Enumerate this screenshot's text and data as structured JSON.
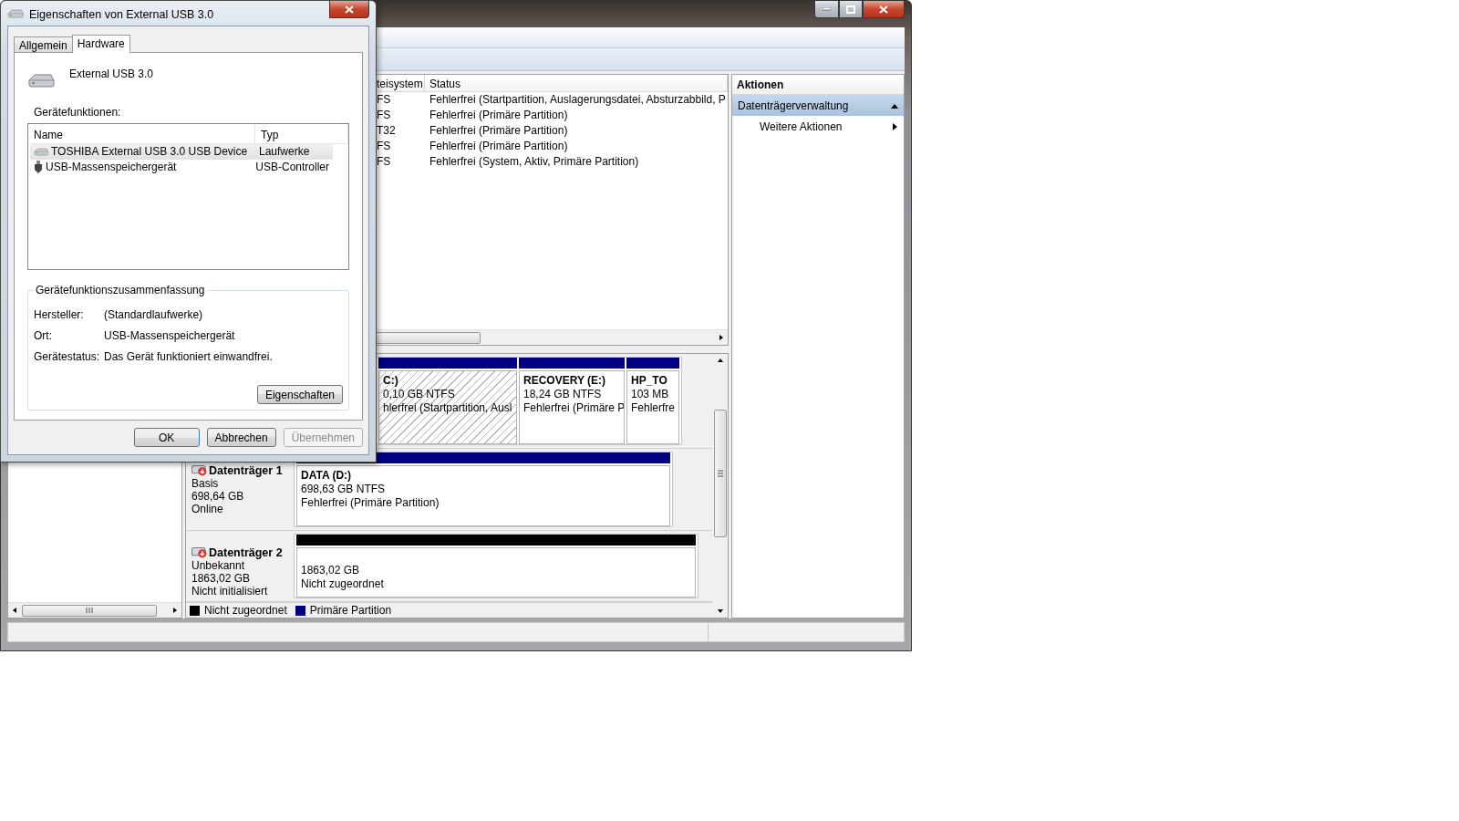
{
  "volume_list": {
    "columns": [
      "teisystem",
      "Status"
    ],
    "rows": [
      [
        "FS",
        "Fehlerfrei (Startpartition, Auslagerungsdatei, Absturzabbild, P"
      ],
      [
        "FS",
        "Fehlerfrei (Primäre Partition)"
      ],
      [
        "T32",
        "Fehlerfrei (Primäre Partition)"
      ],
      [
        "FS",
        "Fehlerfrei (Primäre Partition)"
      ],
      [
        "FS",
        "Fehlerfrei (System, Aktiv, Primäre Partition)"
      ]
    ]
  },
  "disks": [
    {
      "partitions": [
        {
          "kind": "primary",
          "selected": true,
          "lines": [
            "C:)",
            "0,10 GB NTFS",
            "hlerfrei (Startpartition, Ausl"
          ]
        },
        {
          "kind": "primary",
          "selected": false,
          "lines": [
            "RECOVERY  (E:)",
            "18,24 GB NTFS",
            "Fehlerfrei (Primäre P"
          ]
        },
        {
          "kind": "primary",
          "selected": false,
          "lines": [
            "HP_TO",
            "103 MB",
            "Fehlerfre"
          ]
        }
      ]
    },
    {
      "name": "Datenträger 1",
      "details": [
        "Basis",
        "698,64 GB",
        "Online"
      ],
      "partitions": [
        {
          "kind": "primary",
          "selected": false,
          "lines": [
            "DATA  (D:)",
            "698,63 GB NTFS",
            "Fehlerfrei (Primäre Partition)"
          ]
        }
      ]
    },
    {
      "name": "Datenträger 2",
      "details": [
        "Unbekannt",
        "1863,02 GB",
        "Nicht initialisiert"
      ],
      "partitions": [
        {
          "kind": "unallocated",
          "selected": false,
          "lines": [
            "1863,02 GB",
            "Nicht zugeordnet"
          ]
        }
      ]
    }
  ],
  "legend": [
    {
      "label": "Nicht zugeordnet",
      "color": "#000000"
    },
    {
      "label": "Primäre Partition",
      "color": "#000080"
    }
  ],
  "actions": {
    "title": "Aktionen",
    "items": [
      {
        "kind": "section",
        "label": "Datenträgerverwaltung",
        "selected": true
      },
      {
        "kind": "submenu",
        "label": "Weitere Aktionen",
        "selected": false
      }
    ]
  },
  "dialog": {
    "title": "Eigenschaften von External USB 3.0",
    "tabs": [
      {
        "label": "Allgemein",
        "selected": false
      },
      {
        "label": "Hardware",
        "selected": true
      }
    ],
    "device_name": "External USB 3.0",
    "functions_label": "Gerätefunktionen:",
    "columns": [
      "Name",
      "Typ"
    ],
    "rows": [
      {
        "kind": "drive",
        "name": "TOSHIBA External USB 3.0 USB Device",
        "type": "Laufwerke",
        "selected": true
      },
      {
        "kind": "usb",
        "name": "USB-Massenspeichergerät",
        "type": "USB-Controller",
        "selected": false
      }
    ],
    "summary_title": "Gerätefunktionszusammenfassung",
    "summary": [
      {
        "label": "Hersteller:",
        "value": "(Standardlaufwerke)"
      },
      {
        "label": "Ort:",
        "value": "USB-Massenspeichergerät"
      },
      {
        "label": "Gerätestatus:",
        "value": "Das Gerät funktioniert einwandfrei."
      }
    ],
    "properties_button": "Eigenschaften",
    "buttons": [
      {
        "label": "OK",
        "disabled": false,
        "default": true
      },
      {
        "label": "Abbrechen",
        "disabled": false,
        "default": false
      },
      {
        "label": "Übernehmen",
        "disabled": true,
        "default": false
      }
    ]
  }
}
